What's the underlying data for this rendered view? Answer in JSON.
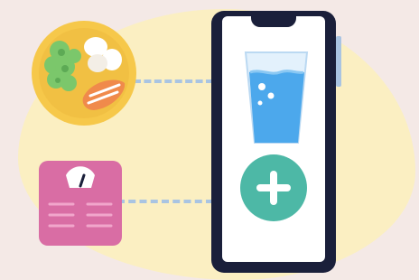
{
  "illustration": {
    "icons": {
      "food": "food-plate-icon",
      "scale": "weight-scale-icon",
      "water": "water-glass-icon",
      "add": "plus-icon"
    },
    "colors": {
      "background": "#F4E9E6",
      "blob": "#FBEFC2",
      "phone_frame": "#1A1F3A",
      "plus_button": "#4DB8A6",
      "water": "#4CA8EC",
      "scale": "#D96DA4",
      "plate": "#F6C84A",
      "connector": "#A9C4E2"
    }
  }
}
